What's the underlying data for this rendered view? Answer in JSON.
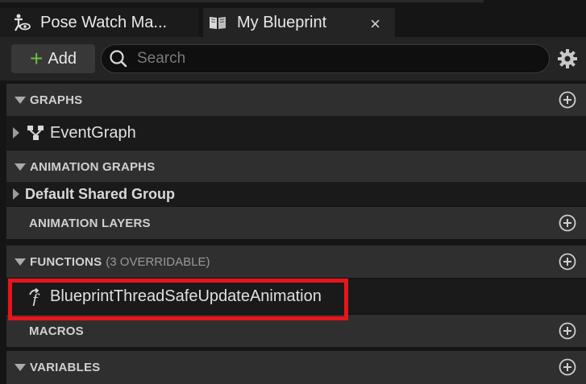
{
  "tabs": [
    {
      "label": "Pose Watch Ma...",
      "icon": "pose-watch-icon",
      "active": false
    },
    {
      "label": "My Blueprint",
      "icon": "book-icon",
      "active": true,
      "close": "×"
    }
  ],
  "toolbar": {
    "add_label": "Add",
    "search_placeholder": "Search"
  },
  "sections": {
    "graphs": {
      "label": "GRAPHS"
    },
    "event_graph": {
      "label": "EventGraph"
    },
    "animation_graphs": {
      "label": "ANIMATION GRAPHS"
    },
    "default_shared_group": {
      "label": "Default Shared Group"
    },
    "animation_layers": {
      "label": "ANIMATION LAYERS"
    },
    "functions": {
      "label": "FUNCTIONS",
      "sub": "(3 OVERRIDABLE)"
    },
    "function_item": {
      "label": "BlueprintThreadSafeUpdateAnimation"
    },
    "macros": {
      "label": "MACROS"
    },
    "variables": {
      "label": "VARIABLES"
    }
  },
  "colors": {
    "accent_add": "#6cbf3a",
    "highlight": "#e8141b"
  }
}
